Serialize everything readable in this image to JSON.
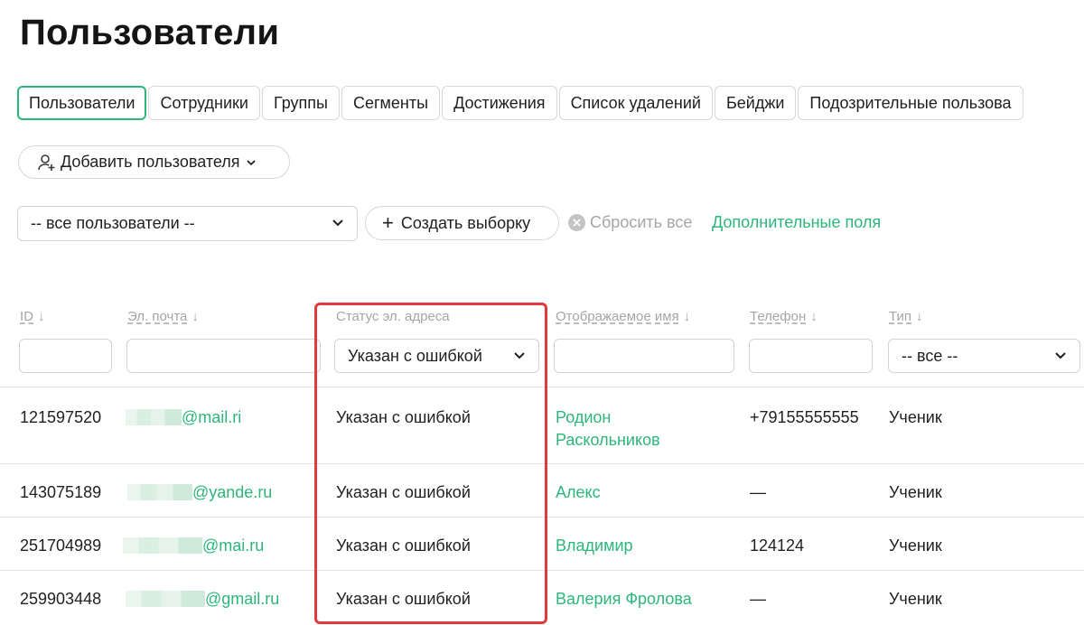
{
  "page": {
    "title": "Пользователи"
  },
  "tabs": [
    {
      "label": "Пользователи",
      "active": true
    },
    {
      "label": "Сотрудники"
    },
    {
      "label": "Группы"
    },
    {
      "label": "Сегменты"
    },
    {
      "label": "Достижения"
    },
    {
      "label": "Список удалений"
    },
    {
      "label": "Бейджи"
    },
    {
      "label": "Подозрительные пользова"
    }
  ],
  "toolbar": {
    "add_user_label": "Добавить пользователя",
    "add_user_icon": "user-plus-icon"
  },
  "filters": {
    "segment_value": "-- все пользователи --",
    "create_selection_label": "Создать выборку",
    "reset_label": "Сбросить все",
    "extra_fields_label": "Дополнительные поля"
  },
  "table": {
    "columns": {
      "id": "ID",
      "email": "Эл. почта",
      "email_status": "Статус эл. адреса",
      "display_name": "Отображаемое имя",
      "phone": "Телефон",
      "type": "Тип"
    },
    "sort_arrow": "↓",
    "filters": {
      "email_status_value": "Указан с ошибкой",
      "type_value": "-- все --"
    },
    "rows": [
      {
        "id": "121597520",
        "email_domain": "@mail.ri",
        "status": "Указан с ошибкой",
        "name": "Родион Раскольников",
        "phone": "+79155555555",
        "type": "Ученик"
      },
      {
        "id": "143075189",
        "email_domain": "@yande.ru",
        "status": "Указан с ошибкой",
        "name": "Алекс",
        "phone": "—",
        "type": "Ученик"
      },
      {
        "id": "251704989",
        "email_domain": "@mai.ru",
        "status": "Указан с ошибкой",
        "name": "Владимир",
        "phone": "124124",
        "type": "Ученик"
      },
      {
        "id": "259903448",
        "email_domain": "@gmail.ru",
        "status": "Указан с ошибкой",
        "name": "Валерия Фролова",
        "phone": "—",
        "type": "Ученик"
      }
    ]
  },
  "colors": {
    "accent": "#2db67c",
    "highlight": "#e0393e",
    "muted": "#a5a5a5"
  }
}
